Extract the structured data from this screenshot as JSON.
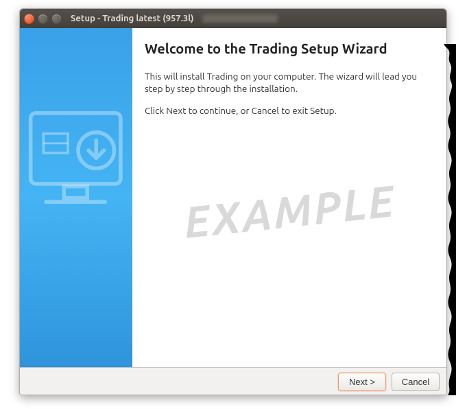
{
  "titlebar": {
    "title": "Setup - Trading latest (957.3l)"
  },
  "wizard": {
    "heading": "Welcome to the Trading Setup Wizard",
    "para1": "This will install Trading on your computer. The wizard will lead you step by step through the installation.",
    "para2": "Click Next to continue, or Cancel to exit Setup."
  },
  "watermark": "EXAMPLE",
  "buttons": {
    "next": "Next >",
    "cancel": "Cancel"
  }
}
